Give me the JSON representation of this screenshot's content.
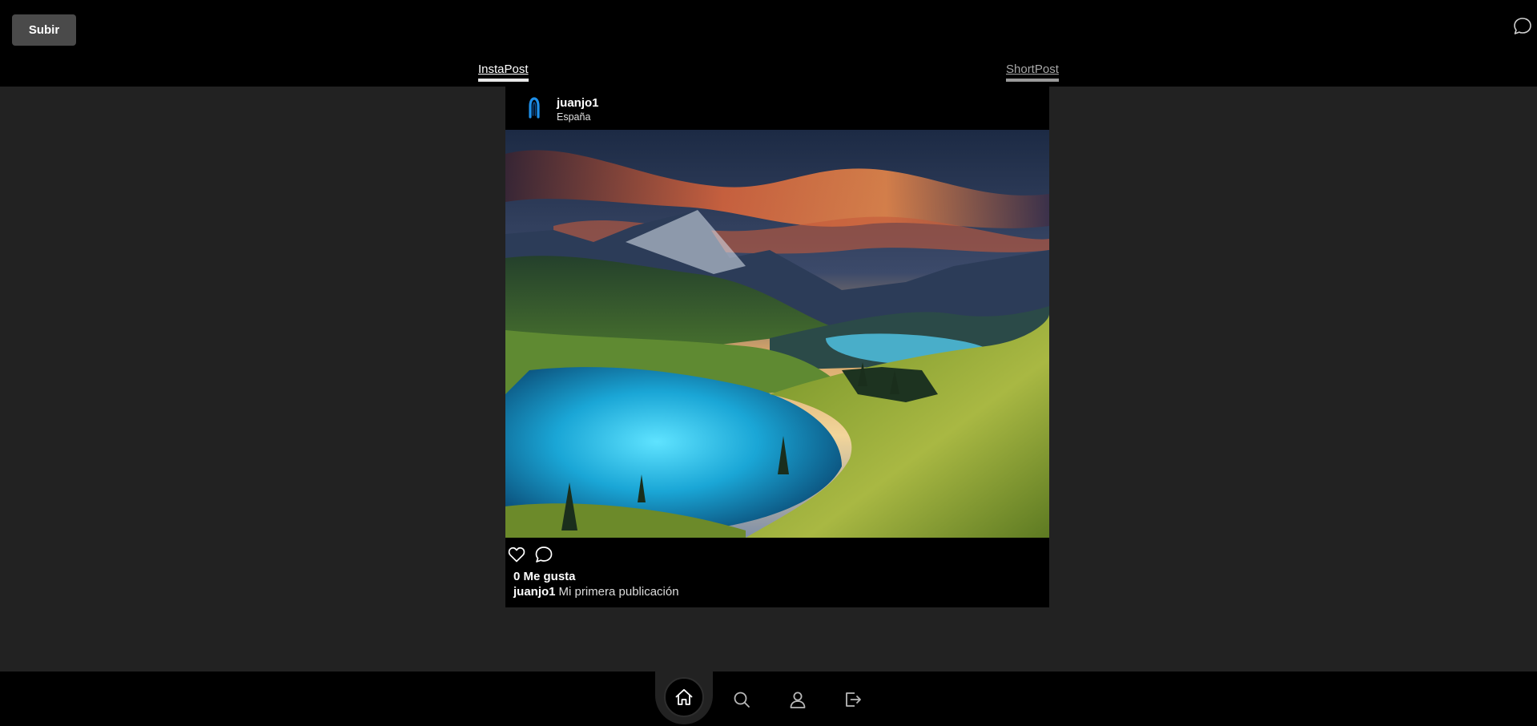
{
  "topbar": {
    "upload_label": "Subir",
    "messages_icon": "chat-bubble-icon"
  },
  "tabs": [
    {
      "label": "InstaPost",
      "active": true
    },
    {
      "label": "ShortPost",
      "active": false
    }
  ],
  "post": {
    "username": "juanjo1",
    "location": "España",
    "avatar_icon": "blue-logo-icon",
    "image_alt": "Mountain lake landscape at sunset",
    "like_icon": "heart-icon",
    "comment_icon": "comment-icon",
    "likes_text": "0 Me gusta",
    "caption_user": "juanjo1",
    "caption_text": "Mi primera publicación"
  },
  "bottom_nav": {
    "items": [
      {
        "icon": "home-icon",
        "active": true
      },
      {
        "icon": "search-icon",
        "active": false
      },
      {
        "icon": "profile-icon",
        "active": false
      },
      {
        "icon": "logout-icon",
        "active": false
      }
    ]
  },
  "colors": {
    "background": "#222222",
    "bars": "#000000",
    "upload_button": "#4a4a4a",
    "avatar_accent": "#1e90ff"
  }
}
